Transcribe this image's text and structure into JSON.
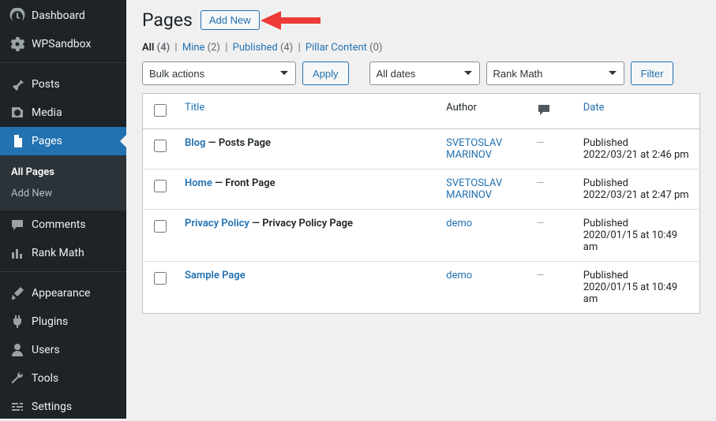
{
  "sidebar": {
    "items": [
      {
        "id": "dashboard",
        "label": "Dashboard"
      },
      {
        "id": "wpsandbox",
        "label": "WPSandbox"
      },
      {
        "id": "posts",
        "label": "Posts"
      },
      {
        "id": "media",
        "label": "Media"
      },
      {
        "id": "pages",
        "label": "Pages",
        "active": true,
        "submenu": [
          {
            "id": "all-pages",
            "label": "All Pages",
            "current": true
          },
          {
            "id": "add-new-sub",
            "label": "Add New"
          }
        ]
      },
      {
        "id": "comments",
        "label": "Comments"
      },
      {
        "id": "rankmath",
        "label": "Rank Math"
      },
      {
        "id": "appearance",
        "label": "Appearance"
      },
      {
        "id": "plugins",
        "label": "Plugins"
      },
      {
        "id": "users",
        "label": "Users"
      },
      {
        "id": "tools",
        "label": "Tools"
      },
      {
        "id": "settings",
        "label": "Settings"
      }
    ]
  },
  "header": {
    "title": "Pages",
    "add_new": "Add New"
  },
  "views": {
    "all": {
      "label": "All",
      "count": "(4)"
    },
    "mine": {
      "label": "Mine",
      "count": "(2)"
    },
    "pub": {
      "label": "Published",
      "count": "(4)"
    },
    "pillar": {
      "label": "Pillar Content",
      "count": "(0)"
    }
  },
  "filters": {
    "bulk_value": "Bulk actions",
    "apply": "Apply",
    "date_value": "All dates",
    "seo_value": "Rank Math",
    "filter": "Filter"
  },
  "columns": {
    "title": "Title",
    "author": "Author",
    "date": "Date"
  },
  "rows": [
    {
      "title": "Blog",
      "state": "Posts Page",
      "author": "SVETOSLAV MARINOV",
      "comments": "—",
      "status": "Published",
      "date": "2022/03/21 at 2:46 pm"
    },
    {
      "title": "Home",
      "state": "Front Page",
      "author": "SVETOSLAV MARINOV",
      "comments": "—",
      "status": "Published",
      "date": "2022/03/21 at 2:47 pm"
    },
    {
      "title": "Privacy Policy",
      "state": "Privacy Policy Page",
      "author": "demo",
      "comments": "—",
      "status": "Published",
      "date": "2020/01/15 at 10:49 am"
    },
    {
      "title": "Sample Page",
      "state": "",
      "author": "demo",
      "comments": "—",
      "status": "Published",
      "date": "2020/01/15 at 10:49 am"
    }
  ]
}
